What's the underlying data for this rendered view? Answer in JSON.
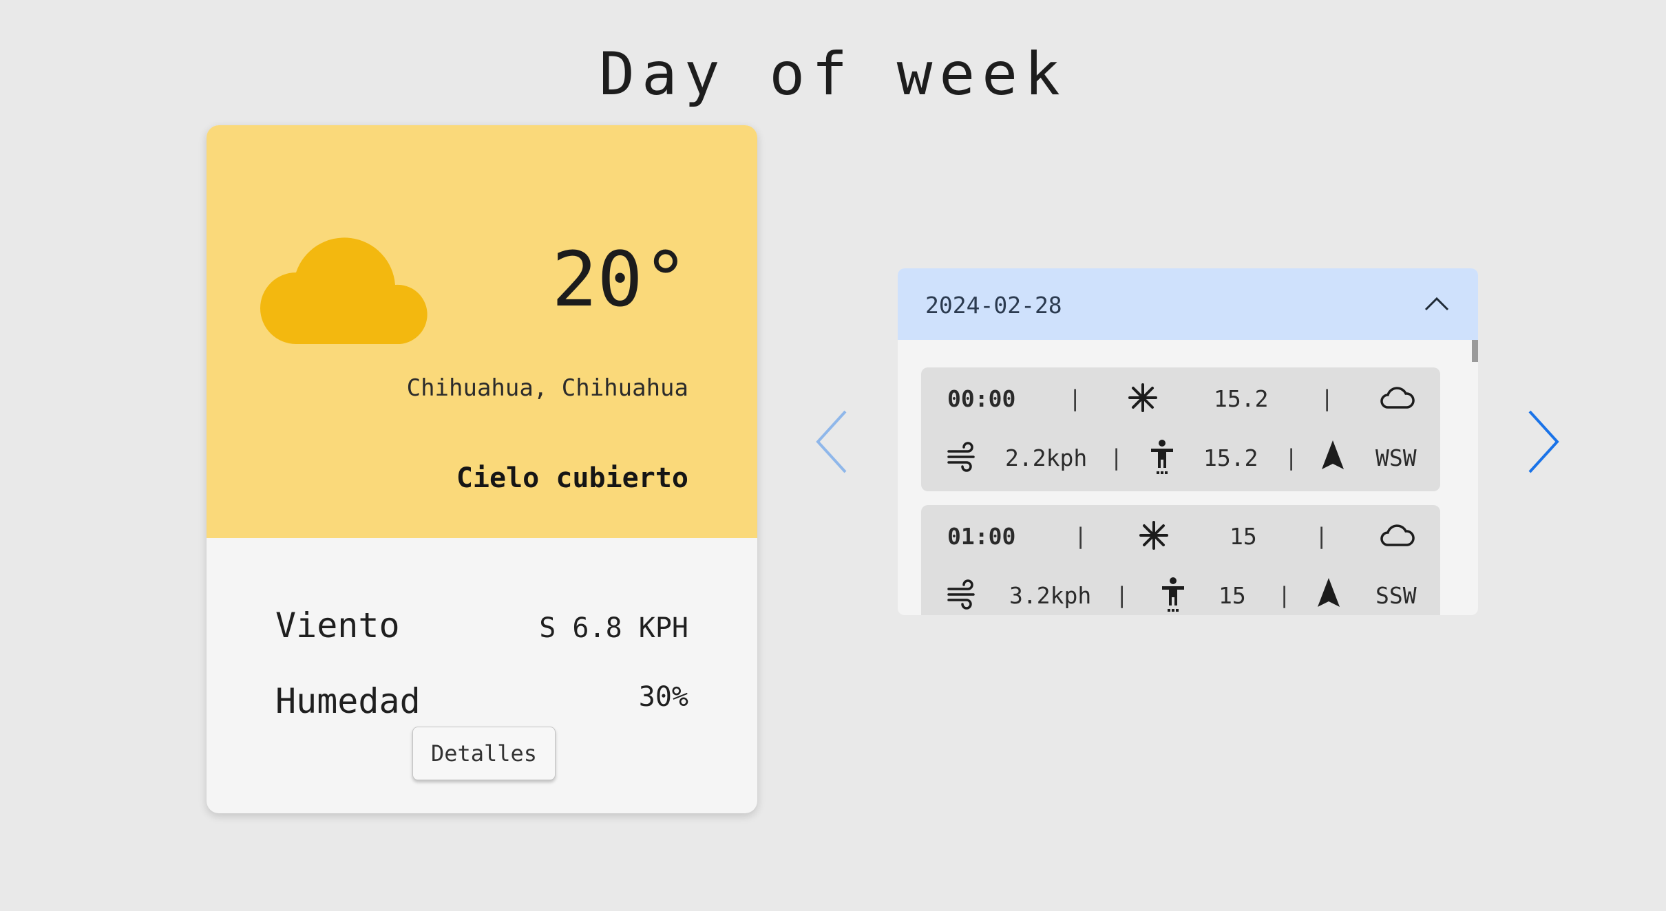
{
  "page": {
    "title": "Day of week"
  },
  "weather_card": {
    "temperature": "20°",
    "location": "Chihuahua, Chihuahua",
    "condition": "Cielo cubierto",
    "rows": [
      {
        "label": "Viento",
        "value": "S 6.8 KPH"
      },
      {
        "label": "Humedad",
        "value": "30%"
      }
    ],
    "details_button": "Detalles",
    "icon": "cloud-icon",
    "colors": {
      "top_bg": "#fad97a",
      "cloud": "#f3b80f"
    }
  },
  "carousel": {
    "prev_icon": "chevron-left-icon",
    "next_icon": "chevron-right-icon",
    "colors": {
      "prev": "#8fb7ea",
      "next": "#1a73e8"
    }
  },
  "forecast": {
    "date": "2024-02-28",
    "expanded": true,
    "header_bg": "#cfe1fc",
    "hours": [
      {
        "time": "00:00",
        "temp": "15.2",
        "wind": "2.2kph",
        "feels_like": "15.2",
        "wind_dir": "WSW",
        "sky_icon": "cloud-outline-icon"
      },
      {
        "time": "01:00",
        "temp": "15",
        "wind": "3.2kph",
        "feels_like": "15",
        "wind_dir": "SSW",
        "sky_icon": "cloud-outline-icon"
      }
    ]
  }
}
